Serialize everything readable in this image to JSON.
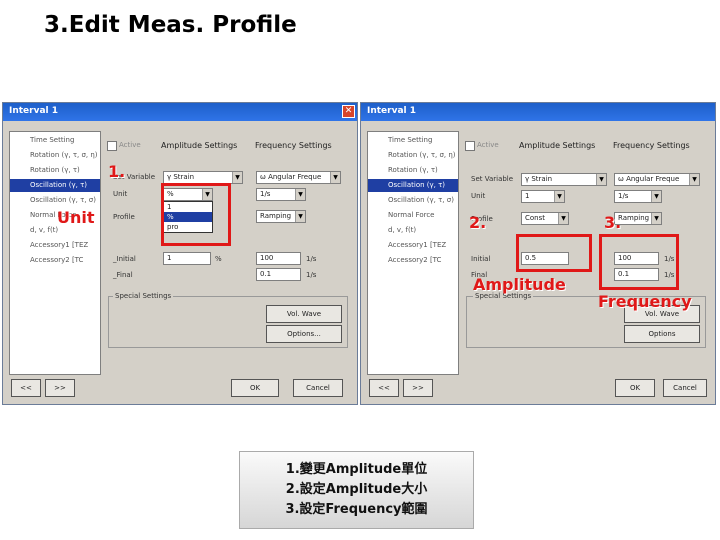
{
  "slide": {
    "title": "3.Edit Meas. Profile"
  },
  "left_dialog": {
    "title": "Interval 1",
    "tree_items": [
      "Time Setting",
      "Rotation (γ, τ, σ, η)",
      "Rotation (γ, τ)",
      "Oscillation (γ, τ)",
      "Oscillation (γ, τ, σ)",
      "Normal Force",
      "d, v, f(t)",
      "Accessory1 [TEZ",
      "Accessory2 [TC"
    ],
    "active_label": "Active",
    "amplitude_settings": "Amplitude Settings",
    "frequency_settings": "Frequency Settings",
    "set_variable_label": "Set Variable",
    "set_variable_value": "γ  Strain",
    "freq_variable_value": "ω  Angular Freque",
    "unit_label": "Unit",
    "unit_value": "%",
    "freq_unit_value": "1/s",
    "profile_label": "Profile",
    "dropdown_options": [
      "1",
      "%",
      "pro"
    ],
    "ramping_value": "Ramping",
    "initial_label": "_Initial",
    "initial_value": "1",
    "initial_unit": "%",
    "freq_initial_value": "100",
    "freq_initial_unit": "1/s",
    "final_label": "_Final",
    "freq_final_value": "0.1",
    "freq_final_unit": "1/s",
    "special_settings": "Special Settings",
    "vol_wave_button": "Vol. Wave",
    "options_button": "Options...",
    "ok_button": "OK",
    "cancel_button": "Cancel",
    "nav_prev": "<<",
    "nav_next": ">>"
  },
  "right_dialog": {
    "title": "Interval 1",
    "tree_items": [
      "Time Setting",
      "Rotation (γ, τ, σ, η)",
      "Rotation (γ, τ)",
      "Oscillation (γ, τ)",
      "Oscillation (γ, τ, σ)",
      "Normal Force",
      "d, v, f(t)",
      "Accessory1 [TEZ",
      "Accessory2 [TC"
    ],
    "active_label": "Active",
    "amplitude_settings": "Amplitude Settings",
    "frequency_settings": "Frequency Settings",
    "set_variable_label": "Set Variable",
    "set_variable_value": "γ  Strain",
    "freq_variable_value": "ω  Angular Freque",
    "unit_label": "Unit",
    "unit_value": "1",
    "freq_unit_value": "1/s",
    "profile_label": "Profile",
    "profile_value": "Const",
    "ramping_value": "Ramping",
    "initial_label": "Initial",
    "initial_value": "0.5",
    "freq_initial_value": "100",
    "freq_initial_unit": "1/s",
    "final_label": "Final",
    "freq_final_value": "0.1",
    "freq_final_unit": "1/s",
    "special_settings": "Special Settings",
    "vol_wave_button": "Vol. Wave",
    "options_button": "Options",
    "ok_button": "OK",
    "cancel_button": "Cancel",
    "nav_prev": "<<",
    "nav_next": ">>"
  },
  "annotations": {
    "step1": "1.",
    "unit": "Unit",
    "step2": "2.",
    "amplitude": "Amplitude",
    "step3": "3.",
    "frequency": "Frequency"
  },
  "notes": [
    "1.變更Amplitude單位",
    "2.設定Amplitude大小",
    "3.設定Frequency範圍"
  ],
  "colors": {
    "annotation_red": "#e01818",
    "titlebar_blue": "#2f74e8",
    "dialog_gray": "#d4d0c8"
  }
}
